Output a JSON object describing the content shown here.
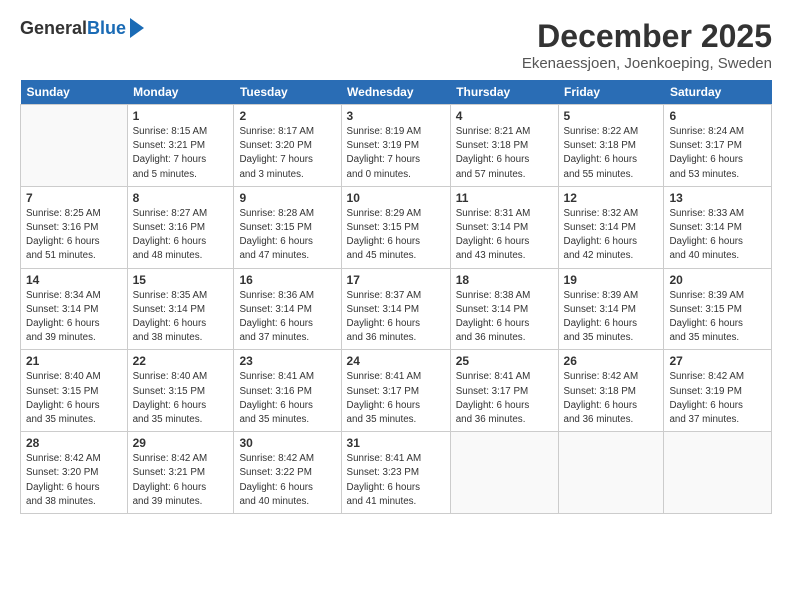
{
  "logo": {
    "general": "General",
    "blue": "Blue"
  },
  "title": "December 2025",
  "subtitle": "Ekenaessjoen, Joenkoeping, Sweden",
  "headers": [
    "Sunday",
    "Monday",
    "Tuesday",
    "Wednesday",
    "Thursday",
    "Friday",
    "Saturday"
  ],
  "weeks": [
    [
      {
        "day": "",
        "info": ""
      },
      {
        "day": "1",
        "info": "Sunrise: 8:15 AM\nSunset: 3:21 PM\nDaylight: 7 hours\nand 5 minutes."
      },
      {
        "day": "2",
        "info": "Sunrise: 8:17 AM\nSunset: 3:20 PM\nDaylight: 7 hours\nand 3 minutes."
      },
      {
        "day": "3",
        "info": "Sunrise: 8:19 AM\nSunset: 3:19 PM\nDaylight: 7 hours\nand 0 minutes."
      },
      {
        "day": "4",
        "info": "Sunrise: 8:21 AM\nSunset: 3:18 PM\nDaylight: 6 hours\nand 57 minutes."
      },
      {
        "day": "5",
        "info": "Sunrise: 8:22 AM\nSunset: 3:18 PM\nDaylight: 6 hours\nand 55 minutes."
      },
      {
        "day": "6",
        "info": "Sunrise: 8:24 AM\nSunset: 3:17 PM\nDaylight: 6 hours\nand 53 minutes."
      }
    ],
    [
      {
        "day": "7",
        "info": "Sunrise: 8:25 AM\nSunset: 3:16 PM\nDaylight: 6 hours\nand 51 minutes."
      },
      {
        "day": "8",
        "info": "Sunrise: 8:27 AM\nSunset: 3:16 PM\nDaylight: 6 hours\nand 48 minutes."
      },
      {
        "day": "9",
        "info": "Sunrise: 8:28 AM\nSunset: 3:15 PM\nDaylight: 6 hours\nand 47 minutes."
      },
      {
        "day": "10",
        "info": "Sunrise: 8:29 AM\nSunset: 3:15 PM\nDaylight: 6 hours\nand 45 minutes."
      },
      {
        "day": "11",
        "info": "Sunrise: 8:31 AM\nSunset: 3:14 PM\nDaylight: 6 hours\nand 43 minutes."
      },
      {
        "day": "12",
        "info": "Sunrise: 8:32 AM\nSunset: 3:14 PM\nDaylight: 6 hours\nand 42 minutes."
      },
      {
        "day": "13",
        "info": "Sunrise: 8:33 AM\nSunset: 3:14 PM\nDaylight: 6 hours\nand 40 minutes."
      }
    ],
    [
      {
        "day": "14",
        "info": "Sunrise: 8:34 AM\nSunset: 3:14 PM\nDaylight: 6 hours\nand 39 minutes."
      },
      {
        "day": "15",
        "info": "Sunrise: 8:35 AM\nSunset: 3:14 PM\nDaylight: 6 hours\nand 38 minutes."
      },
      {
        "day": "16",
        "info": "Sunrise: 8:36 AM\nSunset: 3:14 PM\nDaylight: 6 hours\nand 37 minutes."
      },
      {
        "day": "17",
        "info": "Sunrise: 8:37 AM\nSunset: 3:14 PM\nDaylight: 6 hours\nand 36 minutes."
      },
      {
        "day": "18",
        "info": "Sunrise: 8:38 AM\nSunset: 3:14 PM\nDaylight: 6 hours\nand 36 minutes."
      },
      {
        "day": "19",
        "info": "Sunrise: 8:39 AM\nSunset: 3:14 PM\nDaylight: 6 hours\nand 35 minutes."
      },
      {
        "day": "20",
        "info": "Sunrise: 8:39 AM\nSunset: 3:15 PM\nDaylight: 6 hours\nand 35 minutes."
      }
    ],
    [
      {
        "day": "21",
        "info": "Sunrise: 8:40 AM\nSunset: 3:15 PM\nDaylight: 6 hours\nand 35 minutes."
      },
      {
        "day": "22",
        "info": "Sunrise: 8:40 AM\nSunset: 3:15 PM\nDaylight: 6 hours\nand 35 minutes."
      },
      {
        "day": "23",
        "info": "Sunrise: 8:41 AM\nSunset: 3:16 PM\nDaylight: 6 hours\nand 35 minutes."
      },
      {
        "day": "24",
        "info": "Sunrise: 8:41 AM\nSunset: 3:17 PM\nDaylight: 6 hours\nand 35 minutes."
      },
      {
        "day": "25",
        "info": "Sunrise: 8:41 AM\nSunset: 3:17 PM\nDaylight: 6 hours\nand 36 minutes."
      },
      {
        "day": "26",
        "info": "Sunrise: 8:42 AM\nSunset: 3:18 PM\nDaylight: 6 hours\nand 36 minutes."
      },
      {
        "day": "27",
        "info": "Sunrise: 8:42 AM\nSunset: 3:19 PM\nDaylight: 6 hours\nand 37 minutes."
      }
    ],
    [
      {
        "day": "28",
        "info": "Sunrise: 8:42 AM\nSunset: 3:20 PM\nDaylight: 6 hours\nand 38 minutes."
      },
      {
        "day": "29",
        "info": "Sunrise: 8:42 AM\nSunset: 3:21 PM\nDaylight: 6 hours\nand 39 minutes."
      },
      {
        "day": "30",
        "info": "Sunrise: 8:42 AM\nSunset: 3:22 PM\nDaylight: 6 hours\nand 40 minutes."
      },
      {
        "day": "31",
        "info": "Sunrise: 8:41 AM\nSunset: 3:23 PM\nDaylight: 6 hours\nand 41 minutes."
      },
      {
        "day": "",
        "info": ""
      },
      {
        "day": "",
        "info": ""
      },
      {
        "day": "",
        "info": ""
      }
    ]
  ]
}
